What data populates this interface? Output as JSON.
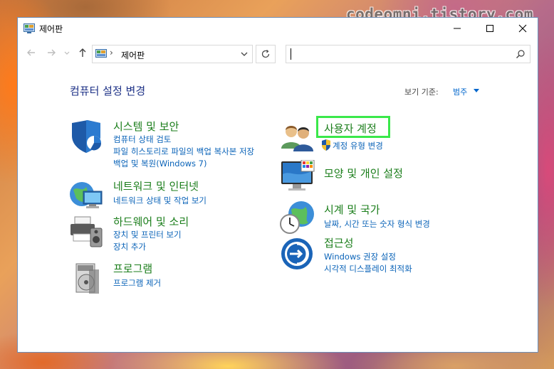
{
  "watermark": "codeomni.tistory.com",
  "window": {
    "title": "제어판"
  },
  "address": {
    "path": "제어판"
  },
  "search": {
    "value": ""
  },
  "main": {
    "heading": "컴퓨터 설정 변경",
    "view_by_label": "보기 기준:",
    "view_by_value": "범주"
  },
  "categories": {
    "system": {
      "icon": "shield-icon",
      "title": "시스템 및 보안",
      "links": [
        "컴퓨터 상태 검토",
        "파일 히스토리로 파일의 백업 복사본 저장",
        "백업 및 복원(Windows 7)"
      ]
    },
    "network": {
      "icon": "network-globe-icon",
      "title": "네트워크 및 인터넷",
      "links": [
        "네트워크 상태 및 작업 보기"
      ]
    },
    "hardware": {
      "icon": "printer-speaker-icon",
      "title": "하드웨어 및 소리",
      "links": [
        "장치 및 프린터 보기",
        "장치 추가"
      ]
    },
    "programs": {
      "icon": "programs-disc-icon",
      "title": "프로그램",
      "links": [
        "프로그램 제거"
      ]
    },
    "users": {
      "icon": "users-icon",
      "title": "사용자 계정",
      "links": [
        "계정 유형 변경"
      ]
    },
    "appearance": {
      "icon": "monitor-color-icon",
      "title": "모양 및 개인 설정",
      "links": []
    },
    "clock": {
      "icon": "clock-globe-icon",
      "title": "시계 및 국가",
      "links": [
        "날짜, 시간 또는 숫자 형식 변경"
      ]
    },
    "access": {
      "icon": "accessibility-icon",
      "title": "접근성",
      "links": [
        "Windows 권장 설정",
        "시각적 디스플레이 최적화"
      ]
    }
  },
  "colors": {
    "category_title": "#1b7e1b",
    "link": "#0a63b8",
    "heading": "#1e3287",
    "highlight": "#3ae84a"
  }
}
